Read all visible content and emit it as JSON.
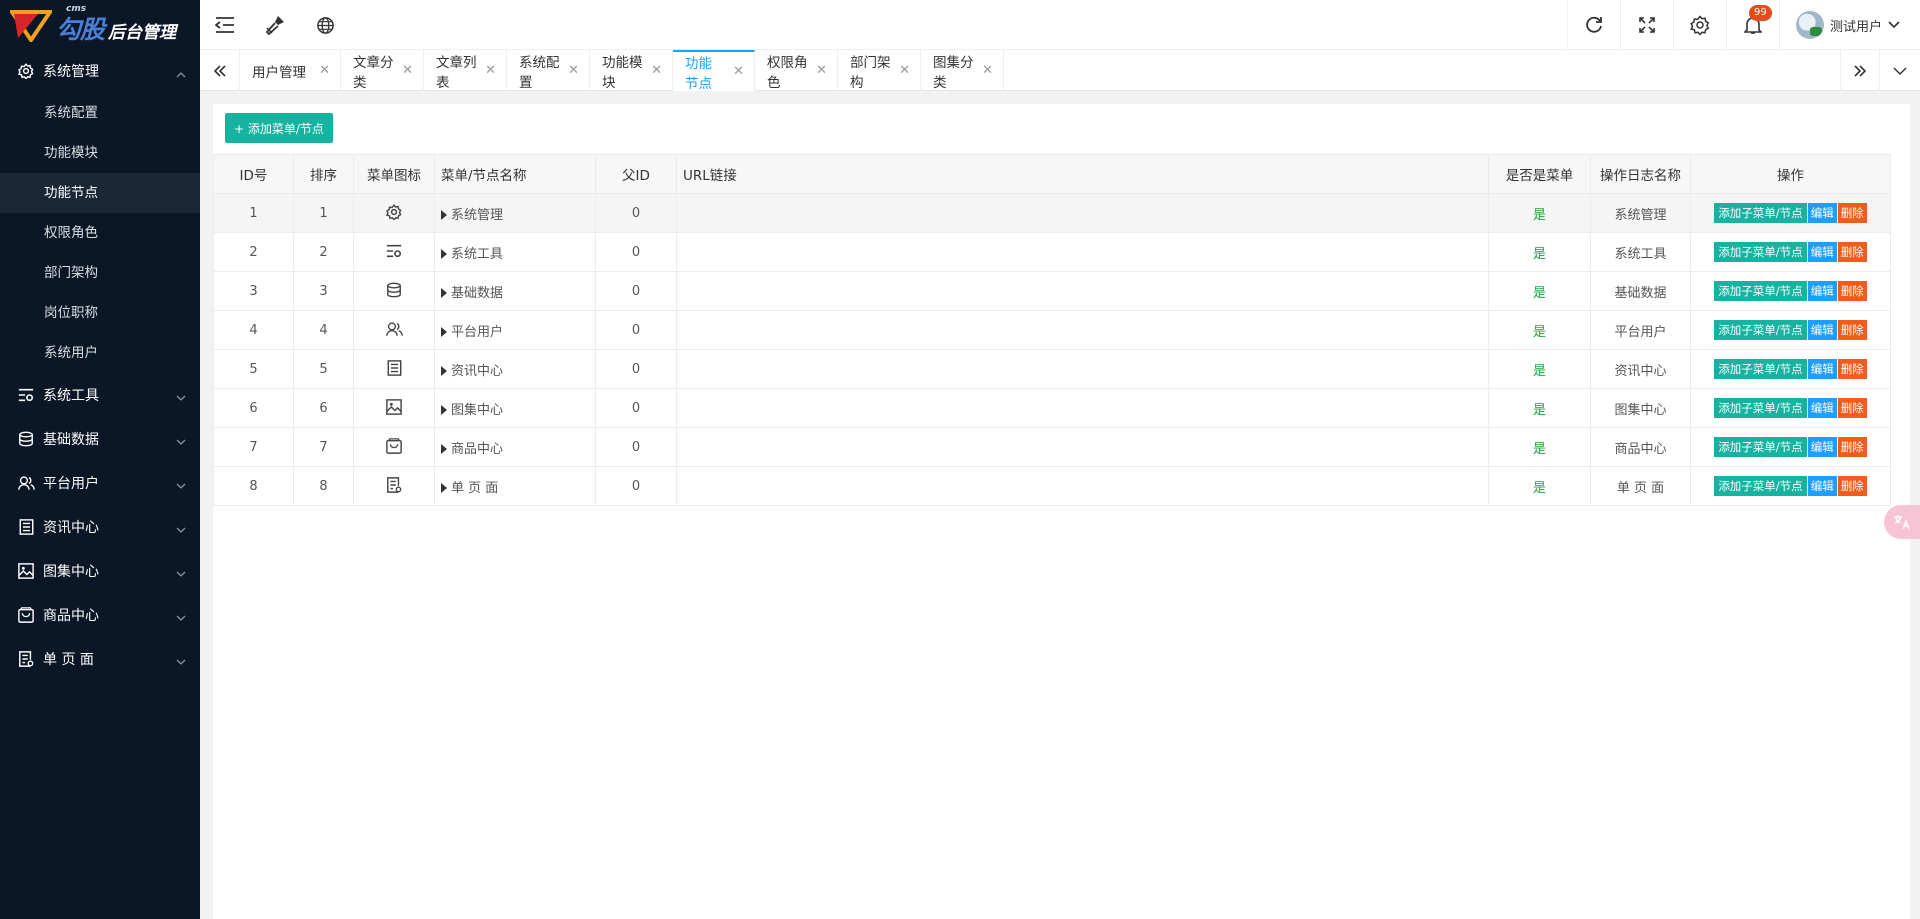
{
  "logo": {
    "cms": "cms",
    "brand": "勾股",
    "suffix": "后台管理"
  },
  "sidebar": {
    "groups": [
      {
        "label": "系统管理",
        "icon": "gear-icon",
        "open": true,
        "items": [
          "系统配置",
          "功能模块",
          "功能节点",
          "权限角色",
          "部门架构",
          "岗位职称",
          "系统用户"
        ],
        "active_item": "功能节点"
      },
      {
        "label": "系统工具",
        "icon": "tools-icon"
      },
      {
        "label": "基础数据",
        "icon": "database-icon"
      },
      {
        "label": "平台用户",
        "icon": "users-icon"
      },
      {
        "label": "资讯中心",
        "icon": "article-icon"
      },
      {
        "label": "图集中心",
        "icon": "image-icon"
      },
      {
        "label": "商品中心",
        "icon": "shop-icon"
      },
      {
        "label": "单 页 面",
        "icon": "page-icon"
      }
    ]
  },
  "header": {
    "notification_count": "99",
    "user_name": "测试用户"
  },
  "tabs": [
    {
      "label": "用户管理"
    },
    {
      "label": "文章分类"
    },
    {
      "label": "文章列表"
    },
    {
      "label": "系统配置"
    },
    {
      "label": "功能模块"
    },
    {
      "label": "功能节点",
      "active": true
    },
    {
      "label": "权限角色"
    },
    {
      "label": "部门架构"
    },
    {
      "label": "图集分类"
    }
  ],
  "main": {
    "add_button": "+ 添加菜单/节点",
    "columns": [
      "ID号",
      "排序",
      "菜单图标",
      "菜单/节点名称",
      "父ID",
      "URL链接",
      "是否是菜单",
      "操作日志名称",
      "操作"
    ],
    "rows": [
      {
        "id": "1",
        "sort": "1",
        "icon": "gear-icon",
        "name": "系统管理",
        "pid": "0",
        "url": "",
        "is_menu": "是",
        "log_name": "系统管理"
      },
      {
        "id": "2",
        "sort": "2",
        "icon": "tools-icon",
        "name": "系统工具",
        "pid": "0",
        "url": "",
        "is_menu": "是",
        "log_name": "系统工具"
      },
      {
        "id": "3",
        "sort": "3",
        "icon": "database-icon",
        "name": "基础数据",
        "pid": "0",
        "url": "",
        "is_menu": "是",
        "log_name": "基础数据"
      },
      {
        "id": "4",
        "sort": "4",
        "icon": "users-icon",
        "name": "平台用户",
        "pid": "0",
        "url": "",
        "is_menu": "是",
        "log_name": "平台用户"
      },
      {
        "id": "5",
        "sort": "5",
        "icon": "article-icon",
        "name": "资讯中心",
        "pid": "0",
        "url": "",
        "is_menu": "是",
        "log_name": "资讯中心"
      },
      {
        "id": "6",
        "sort": "6",
        "icon": "image-icon",
        "name": "图集中心",
        "pid": "0",
        "url": "",
        "is_menu": "是",
        "log_name": "图集中心"
      },
      {
        "id": "7",
        "sort": "7",
        "icon": "shop-icon",
        "name": "商品中心",
        "pid": "0",
        "url": "",
        "is_menu": "是",
        "log_name": "商品中心"
      },
      {
        "id": "8",
        "sort": "8",
        "icon": "page-icon",
        "name": "单 页 面",
        "pid": "0",
        "url": "",
        "is_menu": "是",
        "log_name": "单 页 面"
      }
    ],
    "ops": {
      "add_child": "添加子菜单/节点",
      "edit": "编辑",
      "delete": "删除"
    }
  },
  "colors": {
    "sidebar_bg": "#0b1626",
    "primary": "#16b3a1",
    "blue": "#1e9fff",
    "danger": "#f05c1b",
    "badge": "#e64b1c",
    "yes": "#1fa33b"
  }
}
